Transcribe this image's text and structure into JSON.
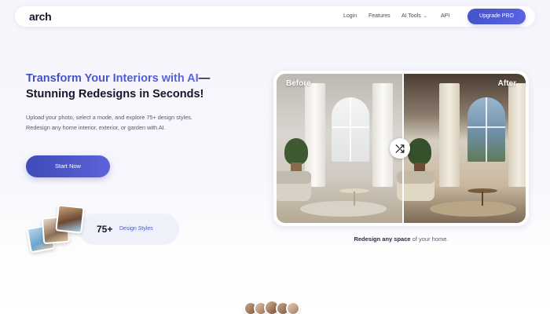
{
  "brand": {
    "logo_text": "arch"
  },
  "nav": {
    "links": [
      "Login",
      "Features",
      "AI Tools",
      "API"
    ],
    "upgrade_label": "Upgrade PRO",
    "accent": "#4c5bd4"
  },
  "hero": {
    "headline_highlight": "Transform Your Interiors with AI",
    "headline_dash": "—",
    "headline_rest": "Stunning Redesigns in Seconds!",
    "subtext": "Upload your photo, select a mode, and explore 75+ design styles. Redesign any home interior, exterior, or garden with AI.",
    "cta_label": "Start Now"
  },
  "badge": {
    "count": "75+",
    "label": "Design Styles"
  },
  "compare": {
    "before_label": "Before",
    "after_label": "After",
    "swap_icon": "shuffle-icon"
  },
  "caption": {
    "bold_part": "Redesign any space",
    "rest": " of your home."
  },
  "colors": {
    "primary_gradient_start": "#3e4bb8",
    "primary_gradient_end": "#5d62d8",
    "badge_bg": "#eef0fa"
  }
}
